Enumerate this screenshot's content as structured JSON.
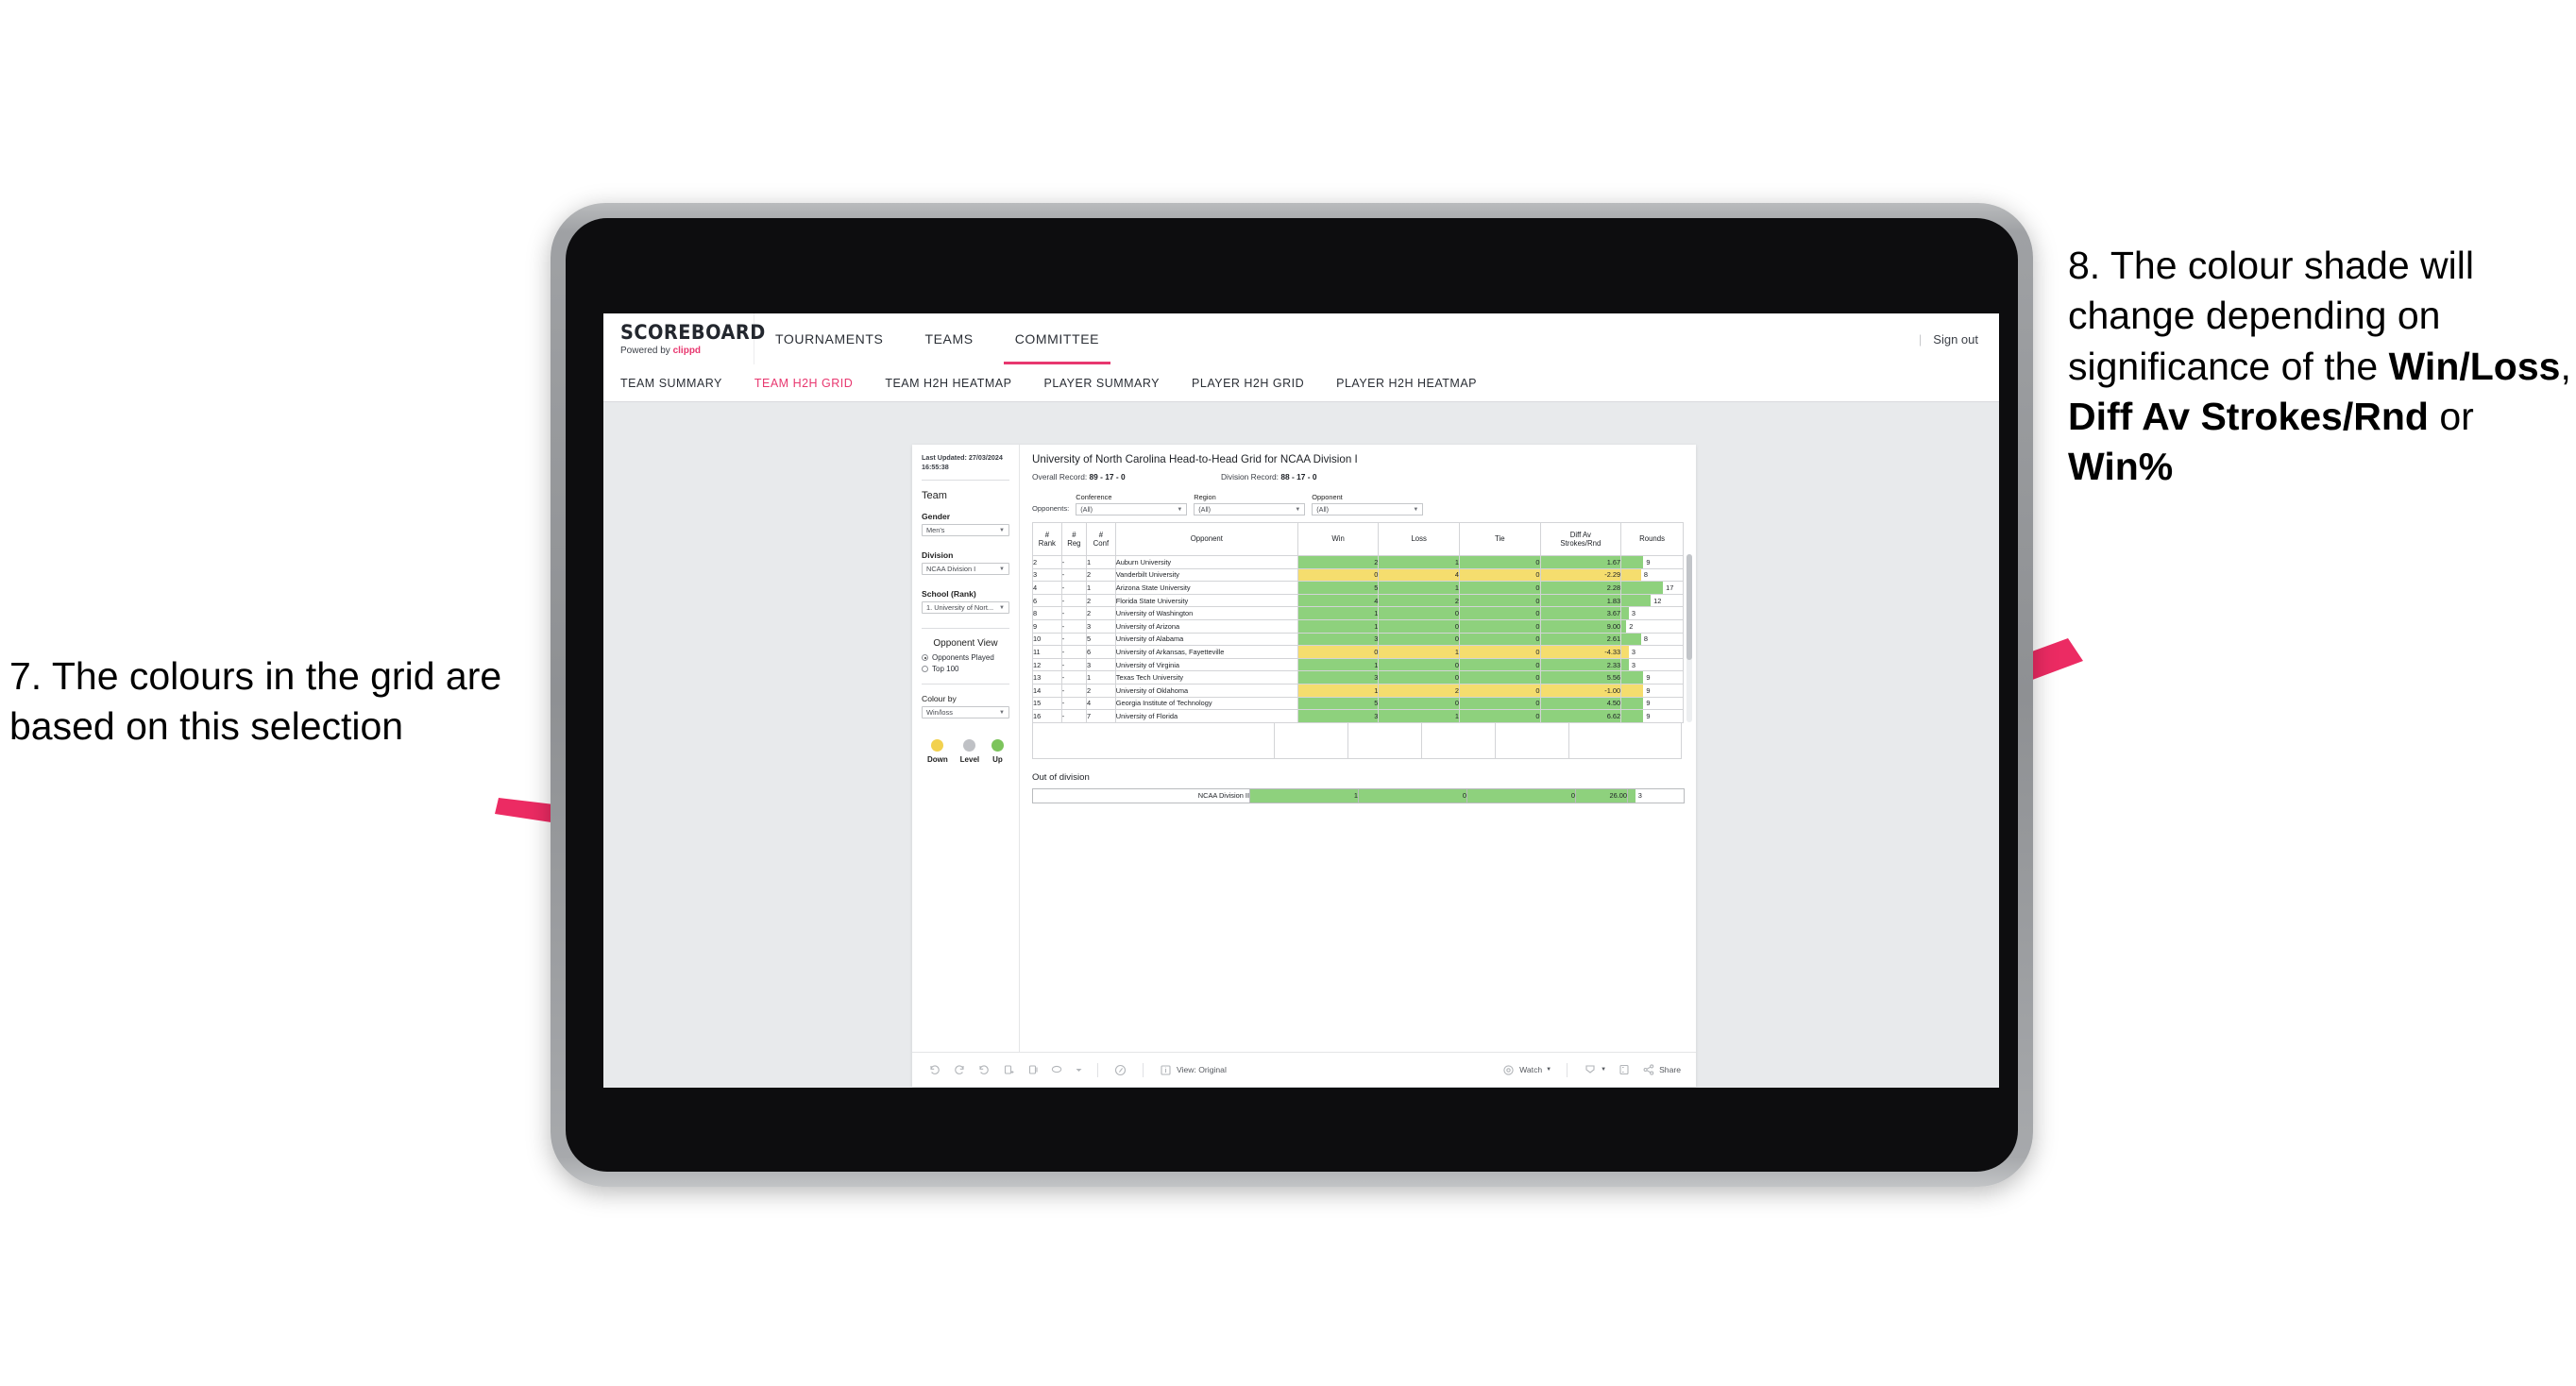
{
  "annotations": {
    "left": {
      "text": "7. The colours in the grid are based on this selection"
    },
    "right": {
      "part1": "8. The colour shade will change depending on significance of the ",
      "bold1": "Win/Loss",
      "mid1": ", ",
      "bold2": "Diff Av Strokes/Rnd",
      "mid2": " or ",
      "bold3": "Win%"
    },
    "arrow_color": "#ec2b63"
  },
  "app": {
    "brand_name": "SCOREBOARD",
    "brand_sub_prefix": "Powered by ",
    "brand_sub_accent": "clippd",
    "accent_color": "#e8376f",
    "top_nav": [
      {
        "label": "TOURNAMENTS",
        "active": false
      },
      {
        "label": "TEAMS",
        "active": false
      },
      {
        "label": "COMMITTEE",
        "active": true
      }
    ],
    "sign_out_separator": "|",
    "sign_out_label": "Sign out",
    "sub_nav": [
      {
        "label": "TEAM SUMMARY",
        "active": false
      },
      {
        "label": "TEAM H2H GRID",
        "active": true
      },
      {
        "label": "TEAM H2H HEATMAP",
        "active": false
      },
      {
        "label": "PLAYER SUMMARY",
        "active": false
      },
      {
        "label": "PLAYER H2H GRID",
        "active": false
      },
      {
        "label": "PLAYER H2H HEATMAP",
        "active": false
      }
    ]
  },
  "sidebar": {
    "last_updated_label": "Last Updated: ",
    "last_updated_value": "27/03/2024 16:55:38",
    "team_heading": "Team",
    "gender_label": "Gender",
    "gender_value": "Men's",
    "division_label": "Division",
    "division_value": "NCAA Division I",
    "school_label": "School (Rank)",
    "school_value": "1. University of Nort...",
    "opponent_view_heading": "Opponent View",
    "opponent_view_options": [
      {
        "label": "Opponents Played",
        "selected": true
      },
      {
        "label": "Top 100",
        "selected": false
      }
    ],
    "colour_by_label": "Colour by",
    "colour_by_value": "Win/loss",
    "legend": [
      {
        "label": "Down",
        "color": "#f2d14f"
      },
      {
        "label": "Level",
        "color": "#bfc1c5"
      },
      {
        "label": "Up",
        "color": "#7cc45c"
      }
    ]
  },
  "main": {
    "title": "University of North Carolina Head-to-Head Grid for NCAA Division I",
    "overall_record_label": "Overall Record: ",
    "overall_record_value": "89 - 17 - 0",
    "division_record_label": "Division Record: ",
    "division_record_value": "88 - 17 - 0",
    "opponents_label": "Opponents:",
    "filters": [
      {
        "label": "Conference",
        "value": "(All)"
      },
      {
        "label": "Region",
        "value": "(All)"
      },
      {
        "label": "Opponent",
        "value": "(All)"
      }
    ],
    "out_of_division_title": "Out of division"
  },
  "chart_data": {
    "type": "table",
    "title": "University of North Carolina Head-to-Head Grid for NCAA Division I",
    "columns": [
      "# Rank",
      "# Reg",
      "# Conf",
      "Opponent",
      "Win",
      "Loss",
      "Tie",
      "Diff Av Strokes/Rnd",
      "Rounds"
    ],
    "column_headers_wrapped": [
      [
        "#",
        "Rank"
      ],
      [
        "#",
        "Reg"
      ],
      [
        "#",
        "Conf"
      ],
      [
        "Opponent"
      ],
      [
        "Win"
      ],
      [
        "Loss"
      ],
      [
        "Tie"
      ],
      [
        "Diff Av",
        "Strokes/Rnd"
      ],
      [
        "Rounds"
      ]
    ],
    "colour_by": "Win/loss",
    "colors": {
      "up": "#8ed17d",
      "down": "#f5dd6e",
      "level": "#bfc1c5"
    },
    "rounds_max": 17,
    "rows": [
      {
        "rank": "2",
        "reg": "-",
        "conf": "1",
        "opponent": "Auburn University",
        "win": "2",
        "loss": "1",
        "tie": "0",
        "diff": "1.67",
        "rounds": 9,
        "state": "up"
      },
      {
        "rank": "3",
        "reg": "-",
        "conf": "2",
        "opponent": "Vanderbilt University",
        "win": "0",
        "loss": "4",
        "tie": "0",
        "diff": "-2.29",
        "rounds": 8,
        "state": "down"
      },
      {
        "rank": "4",
        "reg": "-",
        "conf": "1",
        "opponent": "Arizona State University",
        "win": "5",
        "loss": "1",
        "tie": "0",
        "diff": "2.28",
        "rounds": 17,
        "state": "up"
      },
      {
        "rank": "6",
        "reg": "-",
        "conf": "2",
        "opponent": "Florida State University",
        "win": "4",
        "loss": "2",
        "tie": "0",
        "diff": "1.83",
        "rounds": 12,
        "state": "up"
      },
      {
        "rank": "8",
        "reg": "-",
        "conf": "2",
        "opponent": "University of Washington",
        "win": "1",
        "loss": "0",
        "tie": "0",
        "diff": "3.67",
        "rounds": 3,
        "state": "up"
      },
      {
        "rank": "9",
        "reg": "-",
        "conf": "3",
        "opponent": "University of Arizona",
        "win": "1",
        "loss": "0",
        "tie": "0",
        "diff": "9.00",
        "rounds": 2,
        "state": "up"
      },
      {
        "rank": "10",
        "reg": "-",
        "conf": "5",
        "opponent": "University of Alabama",
        "win": "3",
        "loss": "0",
        "tie": "0",
        "diff": "2.61",
        "rounds": 8,
        "state": "up"
      },
      {
        "rank": "11",
        "reg": "-",
        "conf": "6",
        "opponent": "University of Arkansas, Fayetteville",
        "win": "0",
        "loss": "1",
        "tie": "0",
        "diff": "-4.33",
        "rounds": 3,
        "state": "down"
      },
      {
        "rank": "12",
        "reg": "-",
        "conf": "3",
        "opponent": "University of Virginia",
        "win": "1",
        "loss": "0",
        "tie": "0",
        "diff": "2.33",
        "rounds": 3,
        "state": "up"
      },
      {
        "rank": "13",
        "reg": "-",
        "conf": "1",
        "opponent": "Texas Tech University",
        "win": "3",
        "loss": "0",
        "tie": "0",
        "diff": "5.56",
        "rounds": 9,
        "state": "up"
      },
      {
        "rank": "14",
        "reg": "-",
        "conf": "2",
        "opponent": "University of Oklahoma",
        "win": "1",
        "loss": "2",
        "tie": "0",
        "diff": "-1.00",
        "rounds": 9,
        "state": "down"
      },
      {
        "rank": "15",
        "reg": "-",
        "conf": "4",
        "opponent": "Georgia Institute of Technology",
        "win": "5",
        "loss": "0",
        "tie": "0",
        "diff": "4.50",
        "rounds": 9,
        "state": "up"
      },
      {
        "rank": "16",
        "reg": "-",
        "conf": "7",
        "opponent": "University of Florida",
        "win": "3",
        "loss": "1",
        "tie": "0",
        "diff": "6.62",
        "rounds": 9,
        "state": "up"
      }
    ],
    "out_of_division_rows": [
      {
        "name": "NCAA Division II",
        "win": "1",
        "loss": "0",
        "tie": "0",
        "diff": "26.00",
        "rounds": 3,
        "state": "up"
      }
    ]
  },
  "toolbar": {
    "view_label": "View: Original",
    "watch_label": "Watch",
    "share_label": "Share"
  }
}
